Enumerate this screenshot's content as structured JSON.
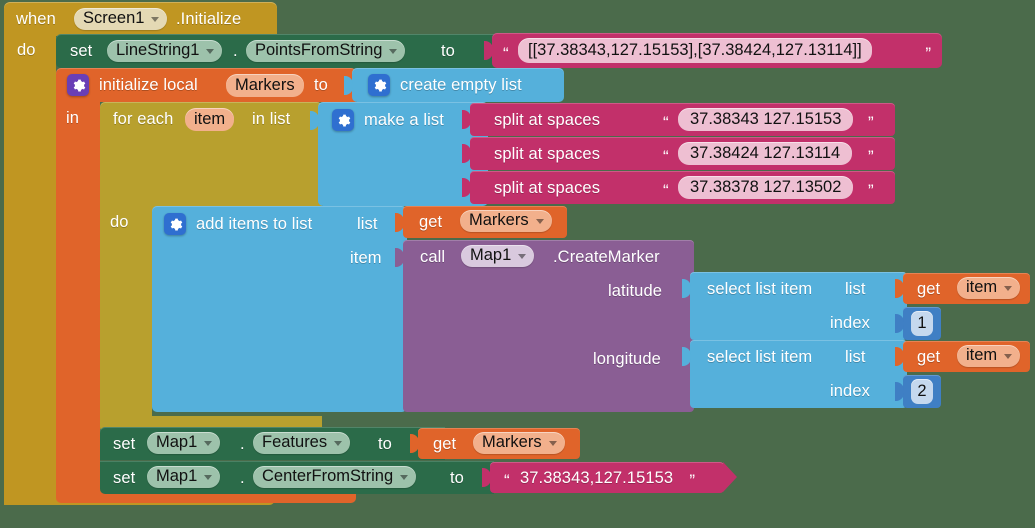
{
  "editor": {
    "app": "MIT App Inventor Blocks Editor",
    "background_color": "#4b6b4b"
  },
  "palette": {
    "event_gold": "#c09622",
    "control_gold": "#b8a02e",
    "setter_green": "#2b6b49",
    "variable_orange": "#e0642a",
    "list_blue": "#55b0db",
    "math_blue": "#3f7fc4",
    "text_crimson": "#c2306a",
    "component_purple": "#8a5e94"
  },
  "event_block": {
    "when_label": "when",
    "component": "Screen1",
    "event": ".Initialize",
    "do_label": "do"
  },
  "set_linestring": {
    "set_label": "set",
    "component": "LineString1",
    "dot": ".",
    "property": "PointsFromString",
    "to_label": "to",
    "value_text": "[[37.38343,127.15153],[37.38424,127.13114]]",
    "quote_open": "“",
    "quote_close": "”"
  },
  "init_local": {
    "gear": "mutator-gear-icon",
    "label": "initialize local",
    "var_name": "Markers",
    "to_label": "to",
    "in_label": "in",
    "value_block": {
      "gear": "mutator-gear-icon",
      "label": "create empty list"
    }
  },
  "for_each": {
    "for_each_label": "for each",
    "loop_var": "item",
    "in_list_label": "in list",
    "do_label": "do",
    "make_a_list": {
      "gear": "mutator-gear-icon",
      "label": "make a list",
      "items": [
        {
          "op": "split at spaces",
          "text": "37.38343 127.15153"
        },
        {
          "op": "split at spaces",
          "text": "37.38424 127.13114"
        },
        {
          "op": "split at spaces",
          "text": "37.38378 127.13502"
        }
      ]
    }
  },
  "add_items": {
    "gear": "mutator-gear-icon",
    "label": "add items to list",
    "list_socket_label": "list",
    "item_socket_label": "item",
    "list_value": {
      "get_label": "get",
      "variable": "Markers"
    },
    "item_value": {
      "call_label": "call",
      "component": "Map1",
      "method": ".CreateMarker",
      "args": [
        {
          "name": "latitude",
          "select": {
            "label": "select list item",
            "list_label": "list",
            "index_label": "index",
            "list_value": {
              "get_label": "get",
              "variable": "item"
            },
            "index_value": "1"
          }
        },
        {
          "name": "longitude",
          "select": {
            "label": "select list item",
            "list_label": "list",
            "index_label": "index",
            "list_value": {
              "get_label": "get",
              "variable": "item"
            },
            "index_value": "2"
          }
        }
      ]
    }
  },
  "set_features": {
    "set_label": "set",
    "component": "Map1",
    "dot": ".",
    "property": "Features",
    "to_label": "to",
    "value": {
      "get_label": "get",
      "variable": "Markers"
    }
  },
  "set_center": {
    "set_label": "set",
    "component": "Map1",
    "dot": ".",
    "property": "CenterFromString",
    "to_label": "to",
    "value_text": "37.38343,127.15153",
    "quote_open": "“",
    "quote_close": "”"
  }
}
